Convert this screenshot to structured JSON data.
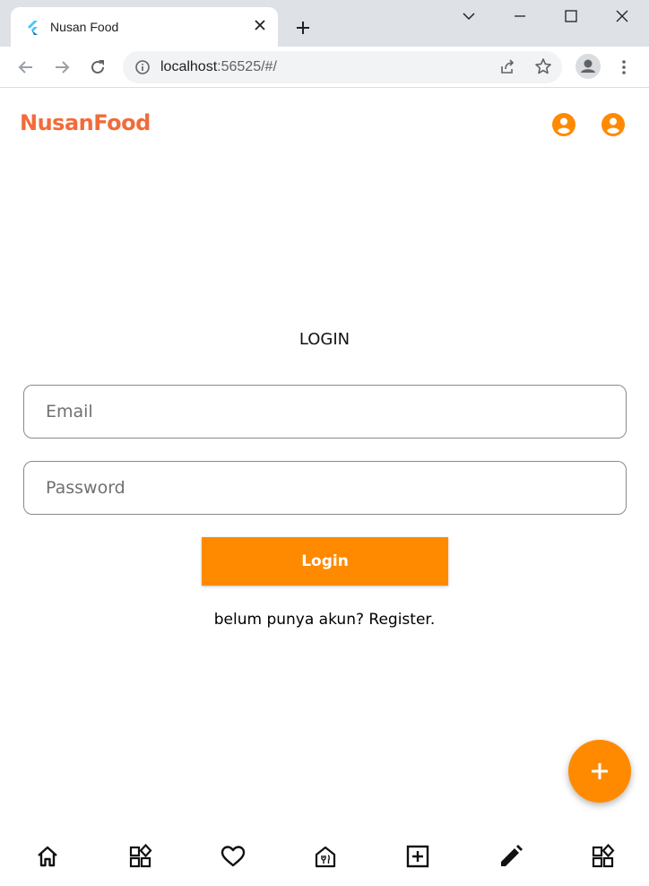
{
  "browser": {
    "tab_title": "Nusan Food",
    "url_host": "localhost",
    "url_rest": ":56525/#/"
  },
  "app": {
    "brand": "NusanFood",
    "brand_color": "#f26b3a",
    "accent_color": "#ff8a00",
    "appbar_icons": [
      "account-circle-icon",
      "account-circle-icon"
    ]
  },
  "login": {
    "title": "LOGIN",
    "email_placeholder": "Email",
    "password_placeholder": "Password",
    "button_label": "Login",
    "register_text": "belum punya akun? Register."
  },
  "fab": {
    "icon": "plus-icon"
  },
  "bottom_nav": {
    "items": [
      "home-icon",
      "category-icon",
      "heart-icon",
      "restaurant-icon",
      "add-box-icon",
      "edit-icon",
      "category-icon"
    ]
  }
}
